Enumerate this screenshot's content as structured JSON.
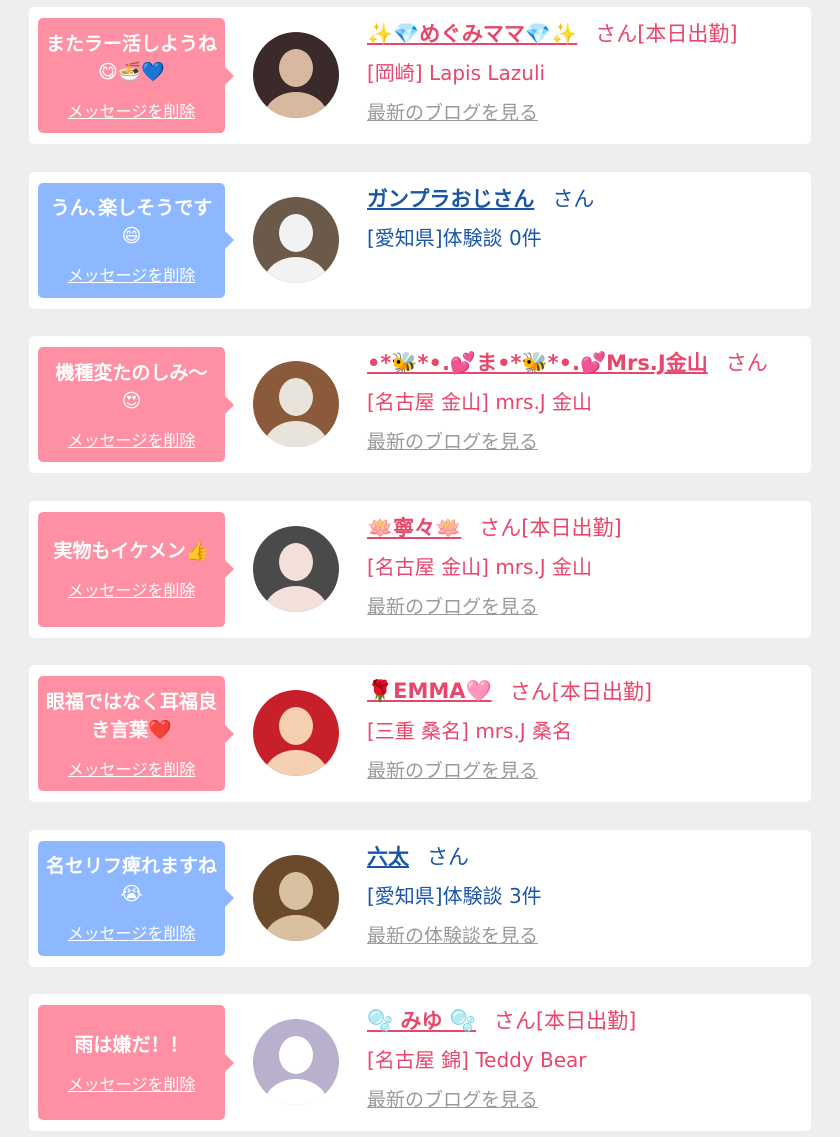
{
  "cards": [
    {
      "color": "pink",
      "message": "またラー活しようね😋🍜💙",
      "delete_label": "メッセージを削除",
      "name": "✨💎めぐみママ💎✨",
      "suffix": "さん[本日出勤]",
      "detail": "[岡崎] Lapis Lazuli",
      "link": "最新のブログを見る"
    },
    {
      "color": "blue",
      "message": "うん､楽しそうです😄",
      "delete_label": "メッセージを削除",
      "name": "ガンプラおじさん",
      "suffix": "さん",
      "detail": "[愛知県]体験談 0件",
      "link": ""
    },
    {
      "color": "pink",
      "message": "機種変たのしみ〜😍",
      "delete_label": "メッセージを削除",
      "name": "•*🐝*•.💕ま•*🐝*•.💕Mrs.J金山",
      "suffix": "さん",
      "detail": "[名古屋 金山] mrs.J 金山",
      "link": "最新のブログを見る"
    },
    {
      "color": "pink",
      "message": "実物もイケメン👍",
      "delete_label": "メッセージを削除",
      "name": "🪷寧々🪷",
      "suffix": "さん[本日出勤]",
      "detail": "[名古屋 金山] mrs.J 金山",
      "link": "最新のブログを見る"
    },
    {
      "color": "pink",
      "message": "眼福ではなく耳福良き言葉❤️",
      "delete_label": "メッセージを削除",
      "name": "🌹EMMA🩷",
      "suffix": "さん[本日出勤]",
      "detail": "[三重 桑名] mrs.J 桑名",
      "link": "最新のブログを見る"
    },
    {
      "color": "blue",
      "message": "名セリフ痺れますね😭",
      "delete_label": "メッセージを削除",
      "name": "六太",
      "suffix": "さん",
      "detail": "[愛知県]体験談 3件",
      "link": "最新の体験談を見る"
    },
    {
      "color": "pink",
      "message": "雨は嫌だ！！",
      "delete_label": "メッセージを削除",
      "name": "🫧 みゆ 🫧",
      "suffix": "さん[本日出勤]",
      "detail": "[名古屋 錦] Teddy Bear",
      "link": "最新のブログを見る"
    }
  ],
  "avatars": [
    {
      "bg": "#3a2a2a",
      "fg": "#d9b8a0"
    },
    {
      "bg": "#6b5a4a",
      "fg": "#f2f2f2"
    },
    {
      "bg": "#8a5a3a",
      "fg": "#e8e4dc"
    },
    {
      "bg": "#4a4a4a",
      "fg": "#f3e0d8"
    },
    {
      "bg": "#c8202a",
      "fg": "#f4d0b0"
    },
    {
      "bg": "#6a4a2a",
      "fg": "#d8c0a0"
    },
    {
      "bg": "#b8b0cc",
      "fg": "#ffffff"
    }
  ],
  "colors": {
    "pink_bubble": "#ff8fa3",
    "blue_bubble": "#8db8ff",
    "pink_text": "#e8466a",
    "blue_text": "#1a56a8",
    "link_gray": "#9a9a9a"
  }
}
